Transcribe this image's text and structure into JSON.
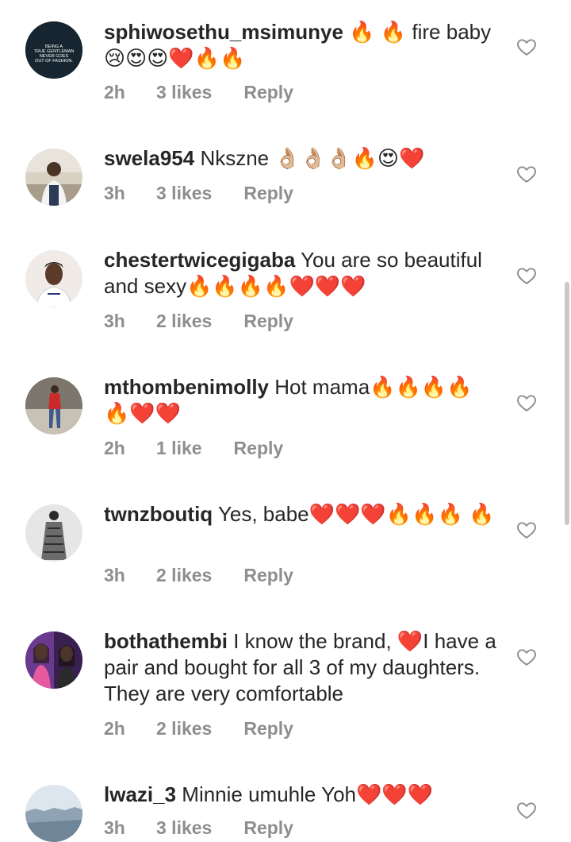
{
  "comments": [
    {
      "username": "sphiwosethu_msimunye",
      "text": " 🔥 🔥 fire baby 😢😍😍❤️🔥🔥",
      "time": "2h",
      "likes": "3 likes",
      "reply": "Reply",
      "avatar_text": "BEING A TRUE GENTLEMAN NEVER GOES OUT OF FASHION."
    },
    {
      "username": "swela954",
      "text": " Nkszne 👌🏼👌🏼👌🏼🔥😍❤️",
      "time": "3h",
      "likes": "3 likes",
      "reply": "Reply"
    },
    {
      "username": "chestertwicegigaba",
      "text": " You are so beautiful and sexy🔥🔥🔥🔥❤️❤️❤️",
      "time": "3h",
      "likes": "2 likes",
      "reply": "Reply"
    },
    {
      "username": "mthombenimolly",
      "text": " Hot mama🔥🔥🔥🔥 🔥❤️❤️",
      "time": "2h",
      "likes": "1 like",
      "reply": "Reply"
    },
    {
      "username": "twnzboutiq",
      "text": " Yes,  babe❤️❤️❤️🔥🔥🔥 🔥",
      "time": "3h",
      "likes": "2 likes",
      "reply": "Reply"
    },
    {
      "username": "bothathembi",
      "text": " I know the brand, ❤️I have a pair and bought for all 3 of my daughters. They are very comfortable",
      "time": "2h",
      "likes": "2 likes",
      "reply": "Reply"
    },
    {
      "username": "lwazi_3",
      "text": " Minnie umuhle Yoh❤️❤️❤️",
      "time": "3h",
      "likes": "3 likes",
      "reply": "Reply"
    }
  ],
  "colors": {
    "text": "#262626",
    "meta": "#8e8e8e",
    "heart": "#8e8e8e",
    "background": "#ffffff"
  },
  "icons": {
    "like": "heart-outline-icon"
  }
}
